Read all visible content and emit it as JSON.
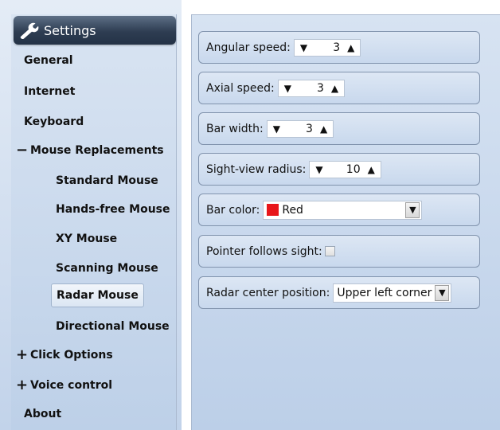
{
  "sidebar": {
    "header_title": "Settings",
    "items": [
      {
        "label": "General",
        "toggle": ""
      },
      {
        "label": "Internet",
        "toggle": ""
      },
      {
        "label": "Keyboard",
        "toggle": ""
      },
      {
        "label": "Mouse Replacements",
        "toggle": "−"
      },
      {
        "label": "Standard Mouse",
        "toggle": ""
      },
      {
        "label": "Hands-free Mouse",
        "toggle": ""
      },
      {
        "label": "XY Mouse",
        "toggle": ""
      },
      {
        "label": "Scanning Mouse",
        "toggle": ""
      },
      {
        "label": "Radar Mouse",
        "toggle": "",
        "selected": true
      },
      {
        "label": "Directional Mouse",
        "toggle": ""
      },
      {
        "label": "Click Options",
        "toggle": "+"
      },
      {
        "label": "Voice control",
        "toggle": "+"
      },
      {
        "label": "About",
        "toggle": ""
      }
    ]
  },
  "settings": {
    "angular_speed": {
      "label": "Angular speed:",
      "value": "3"
    },
    "axial_speed": {
      "label": "Axial speed:",
      "value": "3"
    },
    "bar_width": {
      "label": "Bar width:",
      "value": "3"
    },
    "sight_view_radius": {
      "label": "Sight-view radius:",
      "value": "10"
    },
    "bar_color": {
      "label": "Bar color:",
      "value": "Red",
      "swatch_color": "#e8161a"
    },
    "pointer_follows_sight": {
      "label": "Pointer follows sight:",
      "checked": false
    },
    "radar_center_position": {
      "label": "Radar center position:",
      "value": "Upper left corner"
    }
  },
  "icons": {
    "decrement": "▼",
    "increment": "▲",
    "dropdown": "▼"
  },
  "colors": {
    "header_bg": "#2e3d52",
    "panel_bg": "#c8d8ed",
    "border": "#8193ad"
  }
}
